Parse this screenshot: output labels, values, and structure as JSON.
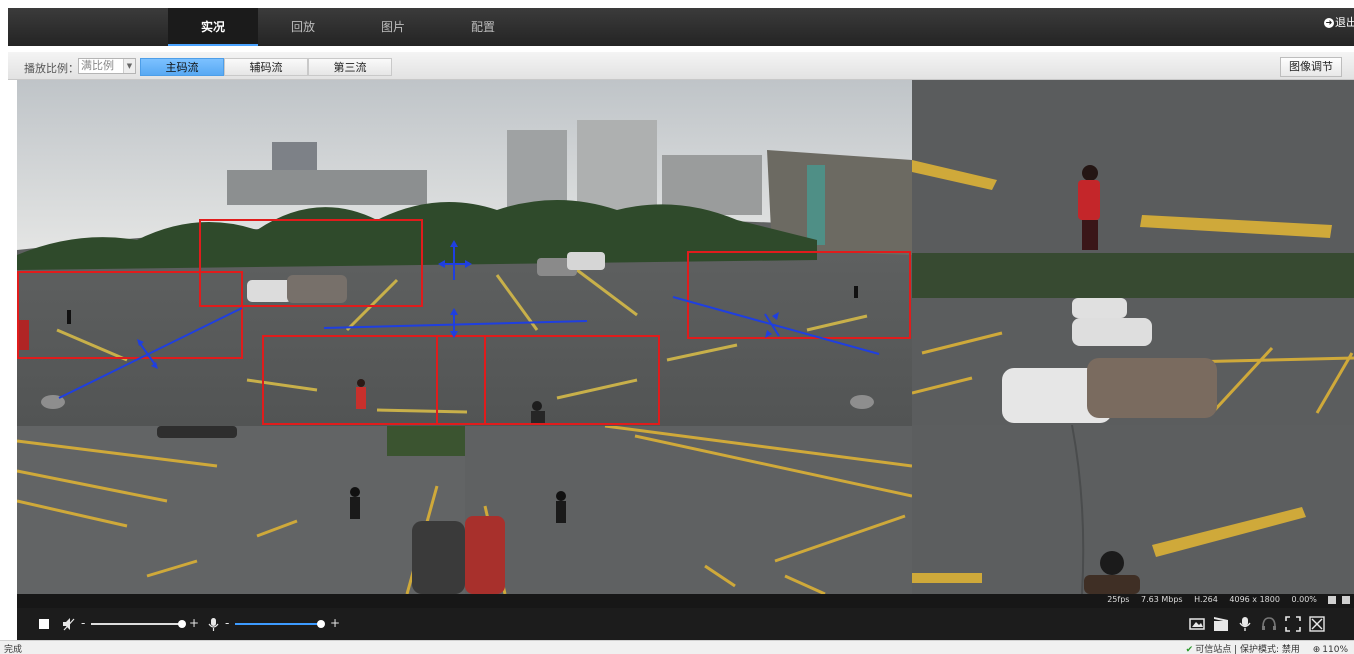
{
  "nav": {
    "tabs": [
      {
        "label": "实况",
        "active": true
      },
      {
        "label": "回放",
        "active": false
      },
      {
        "label": "图片",
        "active": false
      },
      {
        "label": "配置",
        "active": false
      }
    ],
    "logout_label": "退出"
  },
  "toolbar": {
    "ratio_label": "播放比例：",
    "ratio_value": "满比例",
    "streams": [
      {
        "label": "主码流",
        "active": true
      },
      {
        "label": "辅码流",
        "active": false
      },
      {
        "label": "第三流",
        "active": false
      }
    ],
    "image_adjust_label": "图像调节"
  },
  "video": {
    "status": {
      "fps": "25fps",
      "bitrate": "7.63 Mbps",
      "codec": "H.264",
      "resolution": "4096 x 1800",
      "loss": "0.00%"
    },
    "colors": {
      "roi_box": "#e01c1c",
      "ptz_arrow": "#1f3fe0",
      "slider": "#3d9bff"
    }
  },
  "controls": {
    "volume_level": 0.95,
    "mic_level": 0.95,
    "minus": "-",
    "plus": "+"
  },
  "browser": {
    "status_left": "完成",
    "trusted_label": "可信站点 | 保护模式: 禁用",
    "zoom": "110%"
  }
}
